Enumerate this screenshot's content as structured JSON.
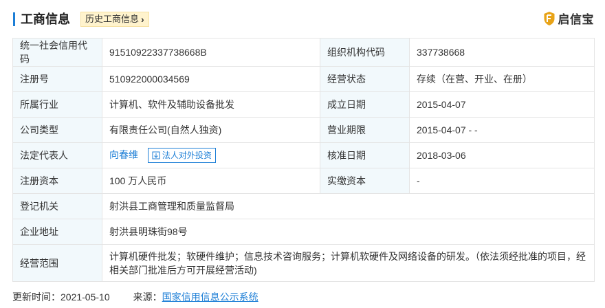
{
  "header": {
    "title": "工商信息",
    "history_label": "历史工商信息",
    "brand_name": "启信宝",
    "brand_icon": "shield-logo-icon",
    "accent_color": "#1c7ed6"
  },
  "table": {
    "credit_code_label": "统一社会信用代码",
    "credit_code_value": "91510922337738668B",
    "org_code_label": "组织机构代码",
    "org_code_value": "337738668",
    "reg_no_label": "注册号",
    "reg_no_value": "510922000034569",
    "status_label": "经营状态",
    "status_value": "存续（在营、开业、在册）",
    "industry_label": "所属行业",
    "industry_value": "计算机、软件及辅助设备批发",
    "founded_label": "成立日期",
    "founded_value": "2015-04-07",
    "type_label": "公司类型",
    "type_value": "有限责任公司(自然人独资)",
    "term_label": "营业期限",
    "term_value": "2015-04-07 - -",
    "rep_label": "法定代表人",
    "rep_name": "向春维",
    "rep_invest_label": "法人对外投资",
    "approved_label": "核准日期",
    "approved_value": "2018-03-06",
    "capital_label": "注册资本",
    "capital_value": "100 万人民币",
    "paid_label": "实缴资本",
    "paid_value": "-",
    "authority_label": "登记机关",
    "authority_value": "射洪县工商管理和质量监督局",
    "address_label": "企业地址",
    "address_value": "射洪县明珠街98号",
    "scope_label": "经营范围",
    "scope_value": "计算机硬件批发；软硬件维护；信息技术咨询服务；计算机软硬件及网络设备的研发。（依法须经批准的项目，经相关部门批准后方可开展经营活动)"
  },
  "footer": {
    "updated_label": "更新时间：",
    "updated_value": "2021-05-10",
    "source_label": "来源：",
    "source_link": "国家信用信息公示系统"
  }
}
